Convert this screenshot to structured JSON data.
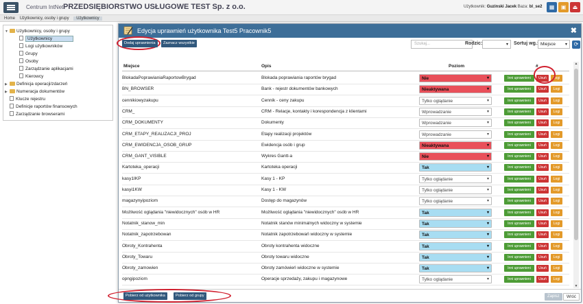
{
  "topbar": {
    "app_name": "Centrum IntNet",
    "company": "PRZEDSIĘBIORSTWO USŁUGOWE TEST Sp. z o.o.",
    "user_label": "Użytkownik:",
    "user_name": "Guzinski Jacek",
    "base_label": "Baza:",
    "base_name": "bl_se2",
    "icon_colors": [
      "#2f6aa5",
      "#e39a2a",
      "#cc3434"
    ]
  },
  "breadcrumb": [
    "Home",
    "Użytkownicy, osoby i grupy",
    "Użytkownicy"
  ],
  "tree": [
    {
      "label": "Użytkownicy, osoby i grupy",
      "level": 0,
      "type": "folder",
      "toggle": "▼"
    },
    {
      "label": "Użytkownicy",
      "level": 1,
      "type": "doc",
      "selected": true
    },
    {
      "label": "Logi użytkowników",
      "level": 1,
      "type": "doc"
    },
    {
      "label": "Grupy",
      "level": 1,
      "type": "doc"
    },
    {
      "label": "Osoby",
      "level": 1,
      "type": "doc"
    },
    {
      "label": "Zarządzanie aplikacjami",
      "level": 1,
      "type": "doc"
    },
    {
      "label": "Kierowcy",
      "level": 1,
      "type": "doc"
    },
    {
      "label": "Definicja operacji/zdarzeń",
      "level": 0,
      "type": "folder",
      "toggle": "▶"
    },
    {
      "label": "Numeracja dokumentów",
      "level": 0,
      "type": "folder",
      "toggle": "▶"
    },
    {
      "label": "Klucze rejestru",
      "level": 0,
      "type": "doc"
    },
    {
      "label": "Definicje raportów finansowych",
      "level": 0,
      "type": "doc"
    },
    {
      "label": "Zarządzanie browserami",
      "level": 0,
      "type": "doc"
    }
  ],
  "modal": {
    "title": "Edycja uprawnień użytkownika Test5 Pracownik5",
    "add_button": "Dodaj uprawnienia",
    "select_all_button": "Zaznacz wszystkie",
    "search_placeholder": "Szukaj...",
    "type_label": "Rodzic:",
    "type_value": "",
    "sort_label": "Sortuj wg.:",
    "sort_value": "Miejsce",
    "headers": {
      "place": "Miejsce",
      "description": "Opis",
      "level": "Poziom",
      "hash": "#"
    },
    "action_labels": {
      "other": "Inni uprawnieni",
      "delete": "Usuń",
      "logs": "Logi"
    },
    "rows": [
      {
        "place": "BlokadaPoprawianiaRaportowBrygad",
        "description": "Blokada poprawiania raportów brygad",
        "level": "Nie",
        "style": "red"
      },
      {
        "place": "BN_BROWSER",
        "description": "Bank - rejestr dokumentów bankowych",
        "level": "Nieaktywana",
        "style": "red"
      },
      {
        "place": "cennikiowyzakupu",
        "description": "Cennik - ceny zakupu",
        "level": "Tylko oglądanie",
        "style": "plain"
      },
      {
        "place": "CRM_",
        "description": "CRM - Relacje, kontakty i korespondencja z klientami",
        "level": "Wprowadzanie",
        "style": "plain"
      },
      {
        "place": "CRM_DOKUMENTY",
        "description": "Dokumenty",
        "level": "Wprowadzanie",
        "style": "plain"
      },
      {
        "place": "CRM_ETAPY_REALIZACJI_PROJ",
        "description": "Etapy realizacji projektów",
        "level": "Wprowadzanie",
        "style": "plain"
      },
      {
        "place": "CRM_EWIDENCJA_OSOB_GRUP",
        "description": "Ewidencja osób i grup",
        "level": "Nieaktywana",
        "style": "red"
      },
      {
        "place": "CRM_GANT_VISIBLE",
        "description": "Wykres Gantt-a",
        "level": "Nie",
        "style": "red"
      },
      {
        "place": "Kartoteka_operacji",
        "description": "Kartoteka operacji",
        "level": "Tak",
        "style": "blue"
      },
      {
        "place": "kasy1IKP",
        "description": "Kasy 1 - KP",
        "level": "Tylko oglądanie",
        "style": "plain"
      },
      {
        "place": "kasyi1KW",
        "description": "Kasy 1 - KW",
        "level": "Tylko oglądanie",
        "style": "plain"
      },
      {
        "place": "magazynyipoziom",
        "description": "Dostęp do magazynów",
        "level": "Tylko oglądanie",
        "style": "plain"
      },
      {
        "place": "Możliwość oglądania \"niewidocznych\" osób w HR",
        "description": "Możliwość oglądania \"niewidocznych\" osób w HR",
        "level": "Tak",
        "style": "blue"
      },
      {
        "place": "Notatnik_stanow_min",
        "description": "Notatnik stanów minimalnych widoczny w systemie",
        "level": "Tak",
        "style": "blue"
      },
      {
        "place": "Notatnik_zapotrzebowan",
        "description": "Notatnik zapotrzebowań widoczny w systemie",
        "level": "Tak",
        "style": "blue"
      },
      {
        "place": "Obroty_Kontrahenta",
        "description": "Obroty kontrahenta widoczne",
        "level": "Tak",
        "style": "blue"
      },
      {
        "place": "Obroty_Towaru",
        "description": "Obroty towaru widoczne",
        "level": "Tak",
        "style": "blue"
      },
      {
        "place": "Obroty_zamowien",
        "description": "Obroty zamówień widoczne w systemie",
        "level": "Tak",
        "style": "blue"
      },
      {
        "place": "opngipoziom",
        "description": "Operacje sprzedaży, zakupu i magazynowe",
        "level": "Tylko oglądanie",
        "style": "plain"
      }
    ],
    "fetch_from_user": "Pobierz od użytkownika",
    "fetch_from_group": "Pobierz od grupy",
    "save": "Zapisz",
    "back": "Wróć"
  }
}
